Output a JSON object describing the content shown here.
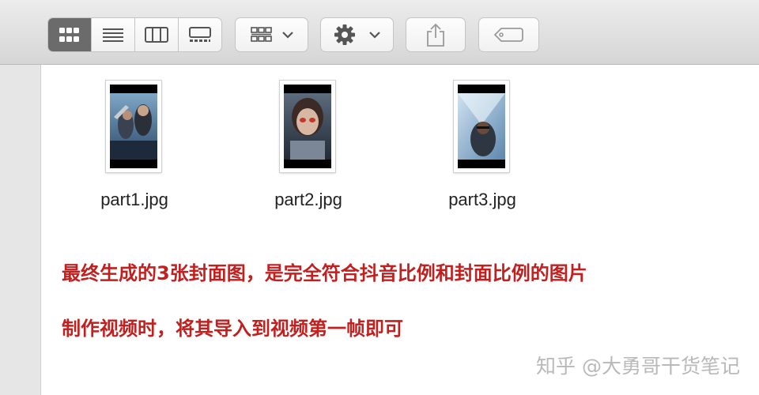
{
  "toolbar": {
    "view_modes": [
      {
        "icon": "icon-view-icon",
        "active": true
      },
      {
        "icon": "list-view-icon",
        "active": false
      },
      {
        "icon": "column-view-icon",
        "active": false
      },
      {
        "icon": "gallery-view-icon",
        "active": false
      }
    ],
    "group_button_icon": "group-by-icon",
    "action_button_icon": "gear-icon",
    "share_button_icon": "share-icon",
    "tags_button_icon": "tag-icon",
    "active_segment_color": "#6b6b6b"
  },
  "files": [
    {
      "name": "part1.jpg",
      "poster": "poster-1"
    },
    {
      "name": "part2.jpg",
      "poster": "poster-2"
    },
    {
      "name": "part3.jpg",
      "poster": "poster-3"
    }
  ],
  "notes": {
    "line1": "最终生成的3张封面图，是完全符合抖音比例和封面比例的图片",
    "line2": "制作视频时，将其导入到视频第一帧即可",
    "color": "#c21f1f"
  },
  "watermark": "知乎 @大勇哥干货笔记"
}
